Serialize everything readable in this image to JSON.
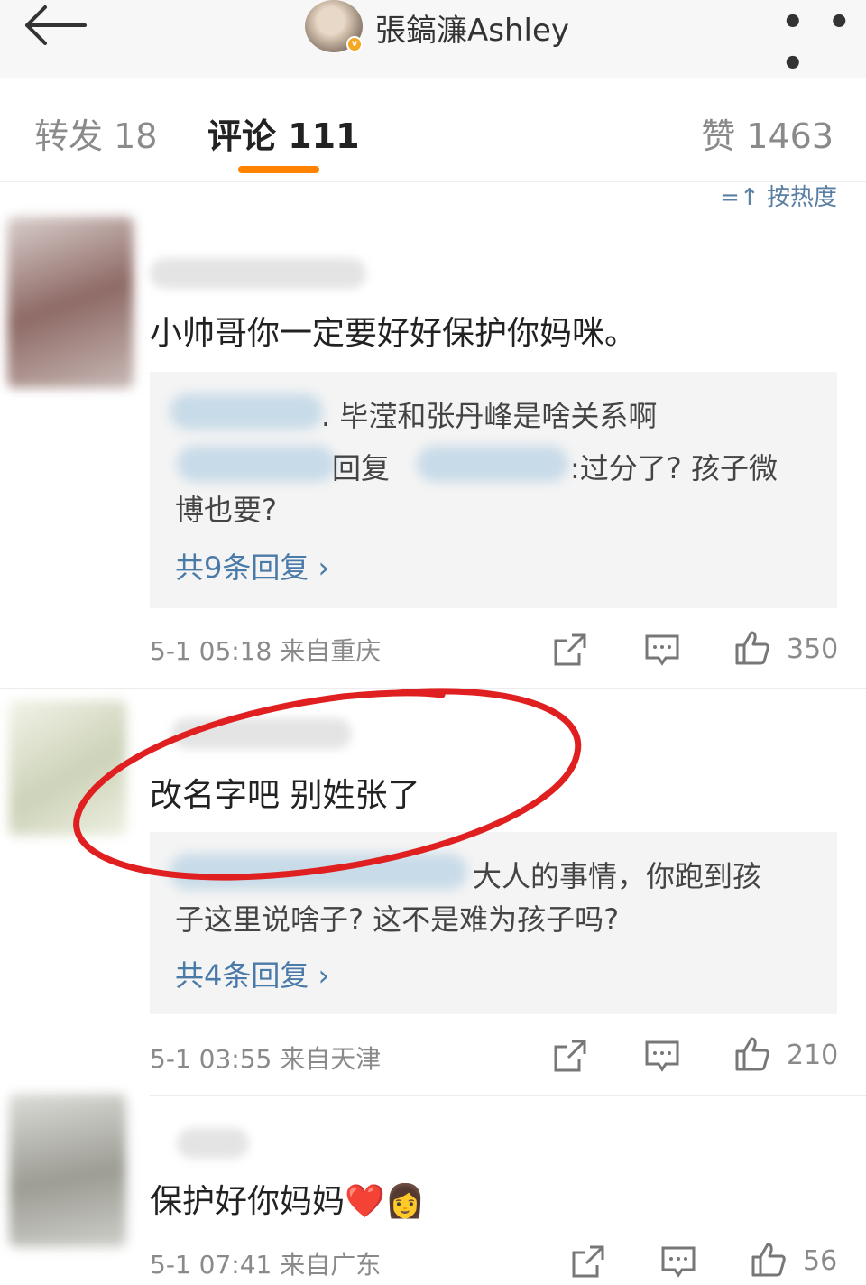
{
  "header": {
    "username": "張鎬濂Ashley",
    "more_label": "• • •"
  },
  "tabs": [
    {
      "label": "转发 18"
    },
    {
      "label": "评论 111"
    },
    {
      "label": "赞 1463"
    }
  ],
  "sort_label": "=↑ 按热度",
  "comments": [
    {
      "text": "小帅哥你一定要好好保护你妈咪。",
      "reply_line1": ". 毕滢和张丹峰是啥关系啊",
      "reply_line2_mid": "回复",
      "reply_line2_end": ":过分了? 孩子微",
      "reply_line3": "博也要?",
      "more_replies": "共9条回复 ›",
      "meta": "5-1 05:18  来自重庆",
      "likes": "350"
    },
    {
      "text": "改名字吧  别姓张了",
      "reply_line1": "大人的事情，你跑到孩",
      "reply_line2": "子这里说啥子? 这不是难为孩子吗?",
      "more_replies": "共4条回复 ›",
      "meta": "5-1 03:55  来自天津",
      "likes": "210"
    },
    {
      "text": "保护好你妈妈❤️👩",
      "meta": "5-1 07:41  来自广东",
      "likes": "56"
    }
  ],
  "colors": {
    "accent": "#ff8200",
    "link": "#4a7aa8",
    "annotation": "#e02020"
  }
}
